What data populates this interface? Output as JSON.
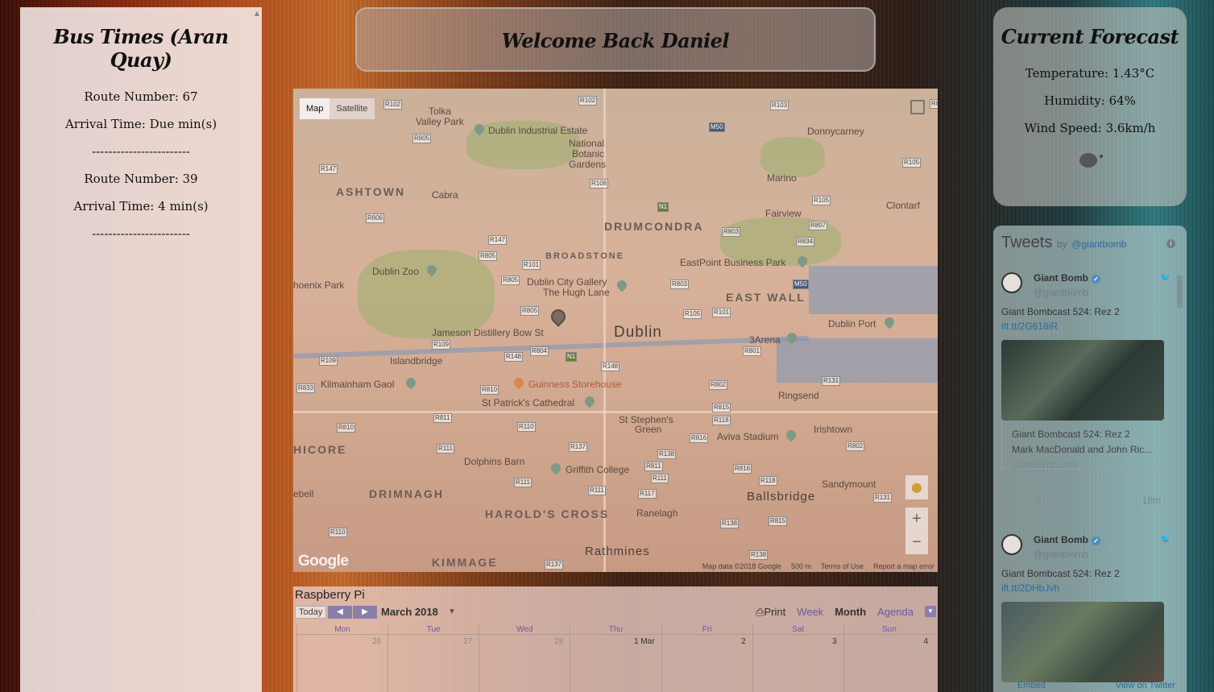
{
  "bus": {
    "title": "Bus Times (Aran Quay)",
    "entries": [
      {
        "route": "Route Number: 67",
        "arrival": "Arrival Time: Due min(s)",
        "divider": "------------------------"
      },
      {
        "route": "Route Number: 39",
        "arrival": "Arrival Time: 4 min(s)",
        "divider": "------------------------"
      }
    ]
  },
  "welcome": {
    "title": "Welcome Back Daniel"
  },
  "map": {
    "type_map": "Map",
    "type_satellite": "Satellite",
    "google": "Google",
    "footer": {
      "data": "Map data ©2018 Google",
      "scale": "500 m",
      "terms": "Terms of Use",
      "report": "Report a map error"
    },
    "zoom_in": "+",
    "zoom_out": "−",
    "places": {
      "tolka": "Tolka",
      "tolka_valley": "Valley Park",
      "dublin_industrial": "Dublin Industrial Estate",
      "botanic1": "National",
      "botanic2": "Botanic",
      "botanic3": "Gardens",
      "donnycarney": "Donnycarney",
      "marino": "Marino",
      "fairview": "Fairview",
      "clontarf": "Clontarf",
      "ashtown": "ASHTOWN",
      "cabra": "Cabra",
      "drumcondra": "DRUMCONDRA",
      "broadstone": "BROADSTONE",
      "dublin_zoo": "Dublin Zoo",
      "phoenix": "hoenix Park",
      "city_gallery1": "Dublin City Gallery",
      "city_gallery2": "The Hugh Lane",
      "eastpoint": "EastPoint Business Park",
      "east_wall": "EAST WALL",
      "dublin": "Dublin",
      "jameson": "Jameson Distillery Bow St",
      "islandbridge": "Islandbridge",
      "arena": "3Arena",
      "dublin_port": "Dublin Port",
      "kilmainham": "Kilmainham Gaol",
      "guinness": "Guinness Storehouse",
      "stpatricks": "St Patrick's Cathedral",
      "ringsend": "Ringsend",
      "ststephens1": "St Stephen's",
      "ststephens2": "Green",
      "irishtown": "Irishtown",
      "aviva": "Aviva Stadium",
      "inchicore": "HICORE",
      "dolphins_barn": "Dolphins Barn",
      "griffith": "Griffith College",
      "sandymount": "Sandymount",
      "drimnagh": "DRIMNAGH",
      "harolds_cross": "HAROLD'S CROSS",
      "ranelagh": "Ranelagh",
      "ballsbridge": "Ballsbridge",
      "bell": "ebell",
      "kimmage": "KIMMAGE",
      "rathmines": "Rathmines"
    },
    "roads": {
      "r102a": "R102",
      "r102b": "R102",
      "r103": "R103",
      "r805a": "R805",
      "m50a": "M50",
      "r105a": "R105",
      "r147a": "R147",
      "r108": "R108",
      "n1a": "N1",
      "r105b": "R105",
      "r806": "R806",
      "r807": "R807",
      "r803a": "R803",
      "r834": "R834",
      "r147b": "R147",
      "r805b": "R805",
      "r101a": "R101",
      "r805c": "R805",
      "r803b": "R803",
      "m50b": "M50",
      "r805d": "R805",
      "r105c": "R105",
      "r101b": "R101",
      "r109a": "R109",
      "r804": "R804",
      "r148a": "R148",
      "n1b": "N1",
      "r801": "R801",
      "r109b": "R109",
      "r148b": "R148",
      "r131": "R131",
      "r833": "R833",
      "r810a": "R810",
      "r802a": "R802",
      "r815": "R815",
      "r118a": "R118",
      "r811a": "R811",
      "r810b": "R810",
      "r110a": "R110",
      "r816": "R816",
      "r802b": "R802",
      "r111a": "R111",
      "r137a": "R137",
      "r138a": "R138",
      "r811b": "R811",
      "r816b": "R816",
      "r111b": "R111",
      "r118b": "R118",
      "r111c": "R111",
      "r117": "R117",
      "r131b": "R131",
      "r110b": "R110",
      "r138b": "R138",
      "r815b": "R815",
      "r138c": "R138",
      "r137b": "R137",
      "r800": "R80"
    }
  },
  "calendar": {
    "title": "Raspberry Pi",
    "today": "Today",
    "prev": "◀",
    "next": "▶",
    "month": "March 2018",
    "month_caret": "▼",
    "print": "Print",
    "views": {
      "week": "Week",
      "month": "Month",
      "agenda": "Agenda"
    },
    "menu_caret": "▼",
    "days": [
      "Mon",
      "Tue",
      "Wed",
      "Thu",
      "Fri",
      "Sat",
      "Sun"
    ],
    "dates": [
      "26",
      "27",
      "28",
      "1 Mar",
      "2",
      "3",
      "4"
    ]
  },
  "forecast": {
    "title": "Current Forecast",
    "temperature": "Temperature: 1.43°C",
    "humidity": "Humidity: 64%",
    "wind": "Wind Speed: 3.6km/h"
  },
  "tweets": {
    "title": "Tweets",
    "by": "by",
    "handle": "@giantbomb",
    "info": "i",
    "items": [
      {
        "name": "Giant Bomb",
        "handle": "@giantbomb",
        "text": "Giant Bombcast 524: Rez 2",
        "link": "ift.tt/2G618iR",
        "card_title": "Giant Bombcast 524: Rez 2",
        "card_desc": "Mark MacDonald and John Ric...",
        "card_domain": "giantbomb.com",
        "time": "18m"
      },
      {
        "name": "Giant Bomb",
        "handle": "@giantbomb",
        "text": "Giant Bombcast 524: Rez 2",
        "link": "ift.tt/2DHbJvh"
      }
    ],
    "footer_embed": "Embed",
    "footer_view": "View on Twitter"
  }
}
